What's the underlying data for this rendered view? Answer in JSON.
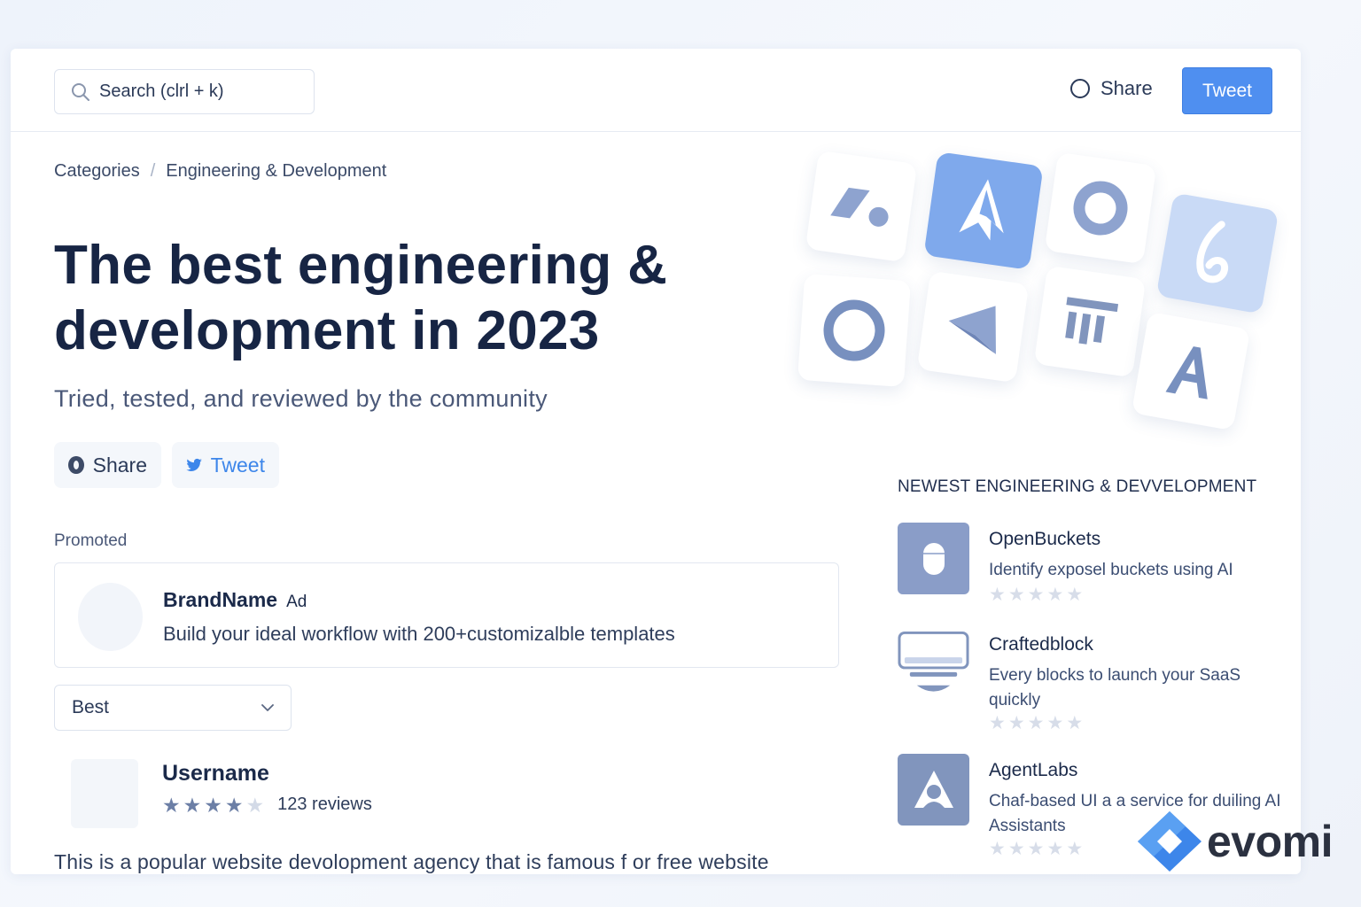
{
  "topbar": {
    "search_placeholder": "Search (clrl + k)",
    "share_label": "Share",
    "tweet_label": "Tweet"
  },
  "breadcrumb": {
    "root": "Categories",
    "separator": "/",
    "current": "Engineering & Development"
  },
  "hero": {
    "title_line1": "The best engineering &",
    "title_line2": "development in 2023",
    "subtitle": "Tried, tested, and reviewed by the community",
    "share_label": "Share",
    "tweet_label": "Tweet"
  },
  "promoted": {
    "label": "Promoted",
    "brand": "BrandName",
    "ad_tag": "Ad",
    "description": "Build your ideal workflow with 200+customizalble templates"
  },
  "sort": {
    "selected": "Best"
  },
  "review": {
    "username": "Username",
    "rating": 4,
    "rating_max": 5,
    "count_text": "123 reviews",
    "text": "This is a popular website devolopment agency that is famous f or free website"
  },
  "newest": {
    "title": "NEWEST ENGINEERING & DEVVELOPMENT",
    "items": [
      {
        "name": "OpenBuckets",
        "description": "Identify exposel buckets using AI",
        "rating": 0,
        "icon": "bucket-icon"
      },
      {
        "name": "Craftedblock",
        "description": "Every blocks to launch your SaaS quickly",
        "rating": 0,
        "icon": "monitor-icon"
      },
      {
        "name": "AgentLabs",
        "description": "Chaf-based UI a a service for duiling AI Assistants",
        "rating": 0,
        "icon": "agent-icon"
      }
    ]
  },
  "watermark": {
    "brand": "evomi"
  },
  "colors": {
    "accent": "#4f8ff0",
    "tile_blue": "#7fa9ec",
    "icon_slate": "#8195bd"
  }
}
